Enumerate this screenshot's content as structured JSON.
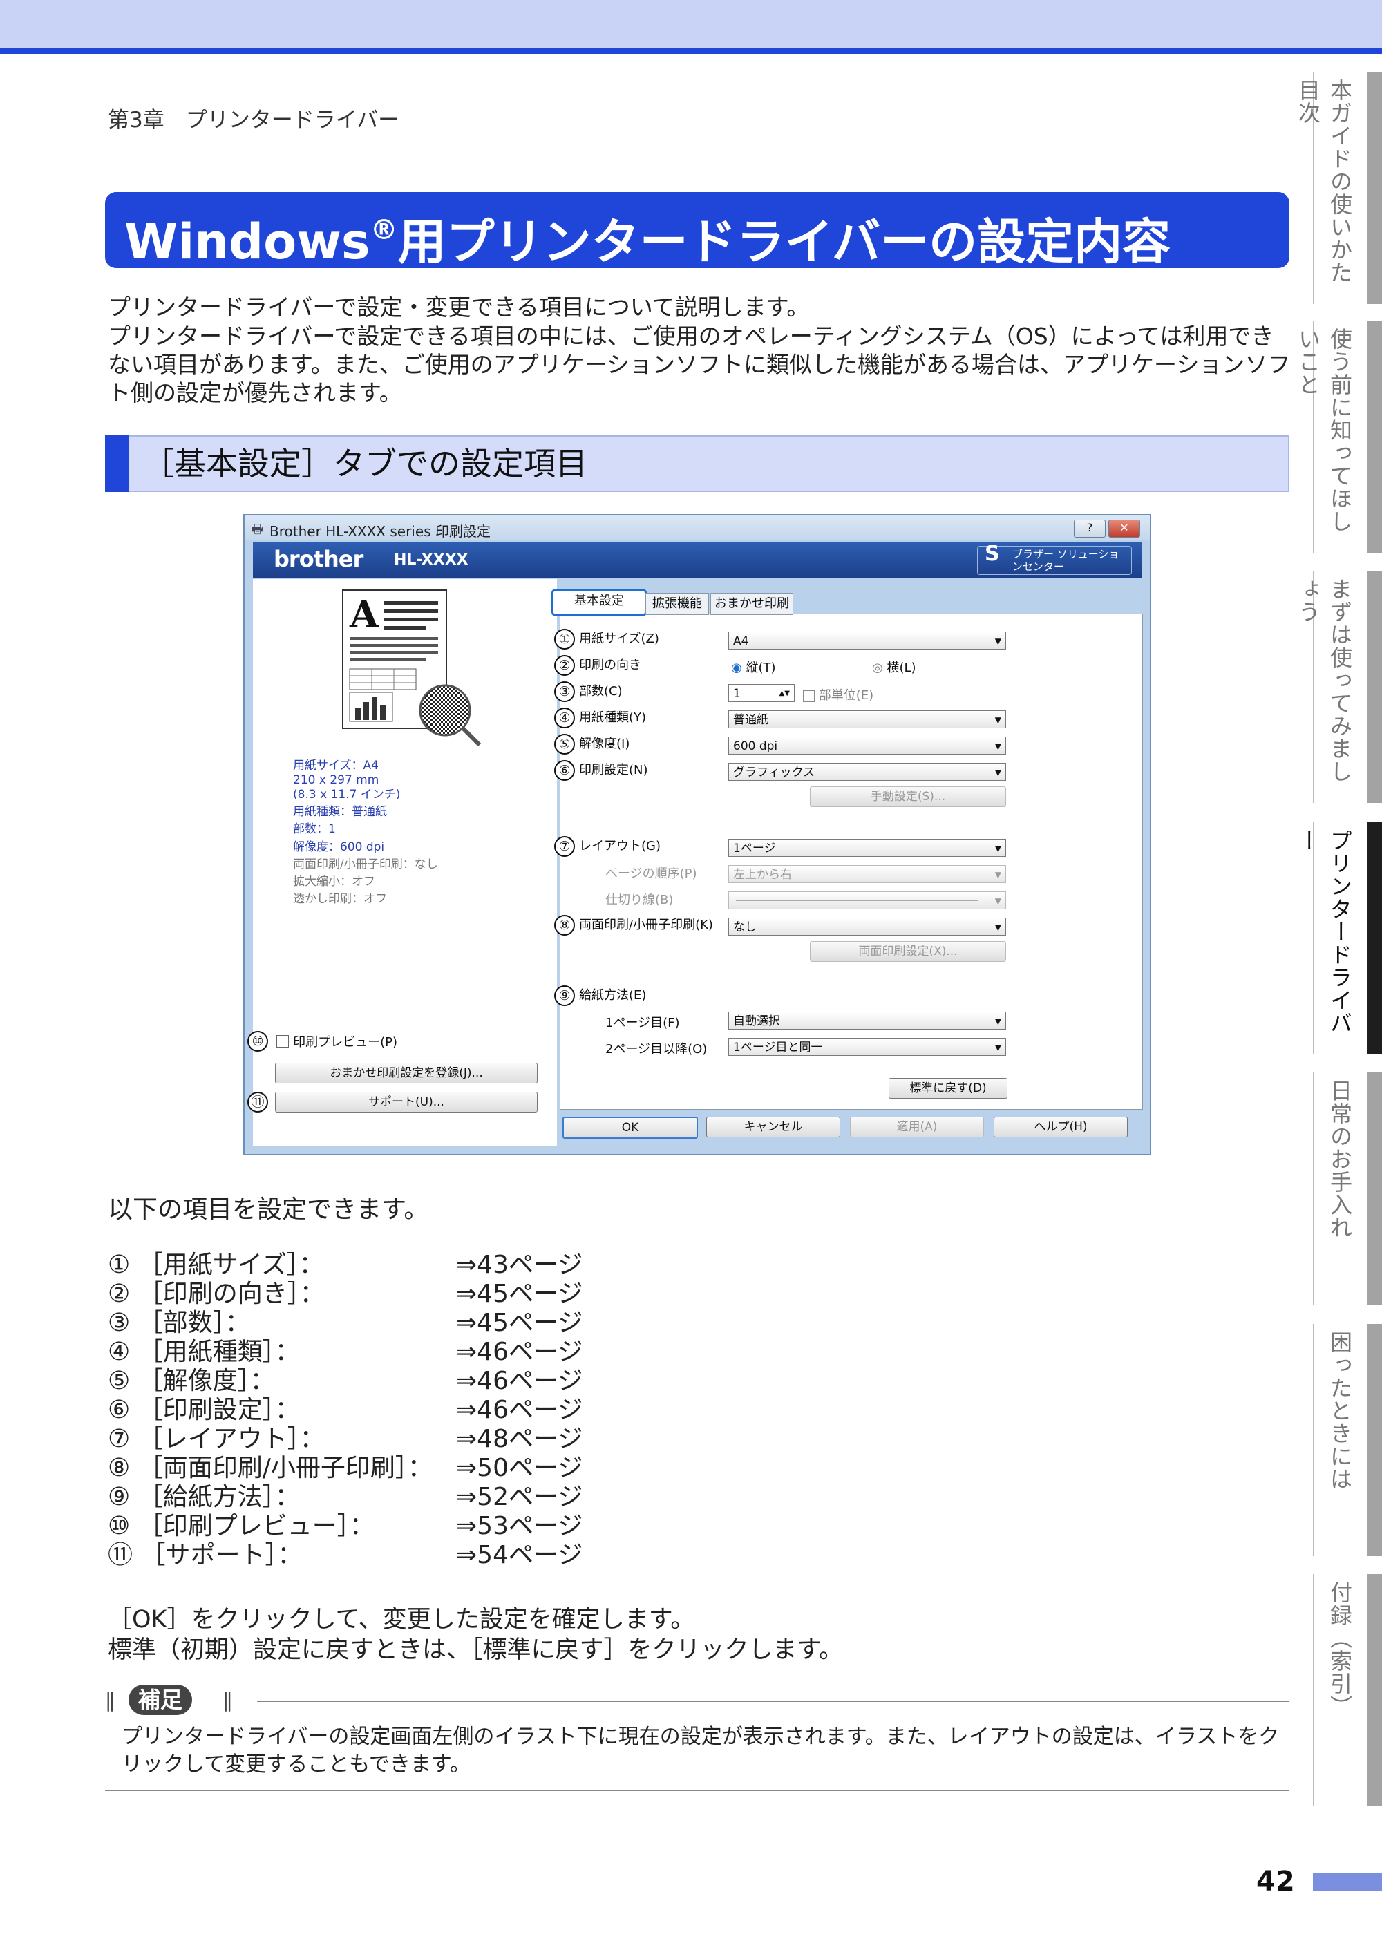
{
  "chapter": "第3章　プリンタードライバー",
  "title": {
    "main": "Windows",
    "sup": "®",
    "rest": "用プリンタードライバーの設定内容"
  },
  "intro": [
    "プリンタードライバーで設定・変更できる項目について説明します。",
    "プリンタードライバーで設定できる項目の中には、ご使用のオペレーティングシステム（OS）によっては利用できない項目があります。また、ご使用のアプリケーションソフトに類似した機能がある場合は、アプリケーションソフト側の設定が優先されます。"
  ],
  "section": "［基本設定］タブでの設定項目",
  "side_tabs": [
    "本ガイドの使いかた目次",
    "使う前に知ってほしいこと",
    "まずは使ってみましょう",
    "プリンタードライバー",
    "日常のお手入れ",
    "困ったときには",
    "付録（索引）"
  ],
  "dialog": {
    "title": "Brother HL-XXXX series 印刷設定",
    "help_btn": "?",
    "close_btn": "✕",
    "brand": "brother",
    "model": "HL-XXXX",
    "solutions": "ブラザー ソリューションセンター",
    "tabs": [
      "基本設定",
      "拡張機能",
      "おまかせ印刷"
    ],
    "rows": [
      {
        "num": "①",
        "label": "用紙サイズ(Z)",
        "value": "A4"
      },
      {
        "num": "②",
        "label": "印刷の向き",
        "portrait": "縦(T)",
        "landscape": "横(L)"
      },
      {
        "num": "③",
        "label": "部数(C)",
        "value": "1",
        "collate": "部単位(E)"
      },
      {
        "num": "④",
        "label": "用紙種類(Y)",
        "value": "普通紙"
      },
      {
        "num": "⑤",
        "label": "解像度(I)",
        "value": "600 dpi"
      },
      {
        "num": "⑥",
        "label": "印刷設定(N)",
        "value": "グラフィックス"
      },
      {
        "num": "⑦",
        "label": "レイアウト(G)",
        "value": "1ページ"
      },
      {
        "num": "⑧",
        "label": "両面印刷/小冊子印刷(K)",
        "value": "なし"
      },
      {
        "num": "⑨",
        "label": "給紙方法(E)"
      }
    ],
    "manual": "手動設定(S)...",
    "page_order_label": "ページの順序(P)",
    "page_order_value": "左上から右",
    "border_label": "仕切り線(B)",
    "duplex_settings": "両面印刷設定(X)...",
    "first_page_label": "1ページ目(F)",
    "first_page_value": "自動選択",
    "other_pages_label": "2ページ目以降(O)",
    "other_pages_value": "1ページ目と同一",
    "default_btn": "標準に戻す(D)",
    "ok": "OK",
    "cancel": "キャンセル",
    "apply": "適用(A)",
    "help": "ヘルプ(H)",
    "left_info": [
      "用紙サイズ：A4",
      "210 x 297 mm",
      "(8.3 x 11.7 インチ)",
      "用紙種類：普通紙",
      "部数：1",
      "解像度：600 dpi",
      "両面印刷/小冊子印刷：なし",
      "拡大縮小：オフ",
      "透かし印刷：オフ"
    ],
    "preview_num": "⑩",
    "preview_label": "印刷プレビュー(P)",
    "register_btn": "おまかせ印刷設定を登録(J)...",
    "support_num": "⑪",
    "support_btn": "サポート(U)..."
  },
  "list_intro": "以下の項目を設定できます。",
  "items": [
    {
      "label": "① ［用紙サイズ］：",
      "ref": "⇒43ページ"
    },
    {
      "label": "② ［印刷の向き］：",
      "ref": "⇒45ページ"
    },
    {
      "label": "③ ［部数］：",
      "ref": "⇒45ページ"
    },
    {
      "label": "④ ［用紙種類］：",
      "ref": "⇒46ページ"
    },
    {
      "label": "⑤ ［解像度］：",
      "ref": "⇒46ページ"
    },
    {
      "label": "⑥ ［印刷設定］：",
      "ref": "⇒46ページ"
    },
    {
      "label": "⑦ ［レイアウト］：",
      "ref": "⇒48ページ"
    },
    {
      "label": "⑧ ［両面印刷/小冊子印刷］：",
      "ref": "⇒50ページ"
    },
    {
      "label": "⑨ ［給紙方法］：",
      "ref": "⇒52ページ"
    },
    {
      "label": "⑩ ［印刷プレビュー］：",
      "ref": "⇒53ページ"
    },
    {
      "label": "⑪ ［サポート］：",
      "ref": "⇒54ページ"
    }
  ],
  "outro": [
    "［OK］をクリックして、変更した設定を確定します。",
    "標準（初期）設定に戻すときは、［標準に戻す］をクリックします。"
  ],
  "note_label": "補足",
  "note_text": "プリンタードライバーの設定画面左側のイラスト下に現在の設定が表示されます。また、レイアウトの設定は、イラストをクリックして変更することもできます。",
  "page_number": "42",
  "colors": {
    "accent": "#1f46d8",
    "light": "#d4dcfa",
    "tab_active": "#1e1e1e"
  }
}
